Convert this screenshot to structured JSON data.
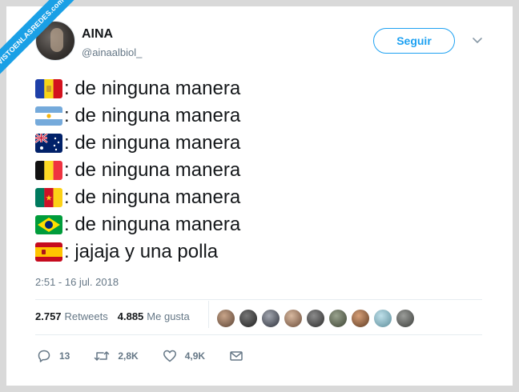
{
  "watermark": "VISTOENLASREDES.com",
  "user": {
    "display_name": "AINA",
    "handle": "@ainaalbiol_"
  },
  "follow_label": "Seguir",
  "tweet": {
    "lines": [
      {
        "flag": "andorra-flag-icon",
        "text": ": de ninguna manera"
      },
      {
        "flag": "argentina-flag-icon",
        "text": ": de ninguna manera"
      },
      {
        "flag": "australia-flag-icon",
        "text": ": de ninguna manera"
      },
      {
        "flag": "belgium-flag-icon",
        "text": ": de ninguna manera"
      },
      {
        "flag": "cameroon-flag-icon",
        "text": ": de ninguna manera"
      },
      {
        "flag": "brazil-flag-icon",
        "text": ": de ninguna manera"
      },
      {
        "flag": "spain-flag-icon",
        "text": ": jajaja y una polla"
      }
    ],
    "timestamp": "2:51 - 16 jul. 2018"
  },
  "stats": {
    "retweets_count": "2.757",
    "retweets_label": "Retweets",
    "likes_count": "4.885",
    "likes_label": "Me gusta"
  },
  "actions": {
    "replies": "13",
    "retweets": "2,8K",
    "likes": "4,9K"
  },
  "colors": {
    "accent": "#1da1f2",
    "text": "#14171a",
    "muted": "#657786"
  }
}
